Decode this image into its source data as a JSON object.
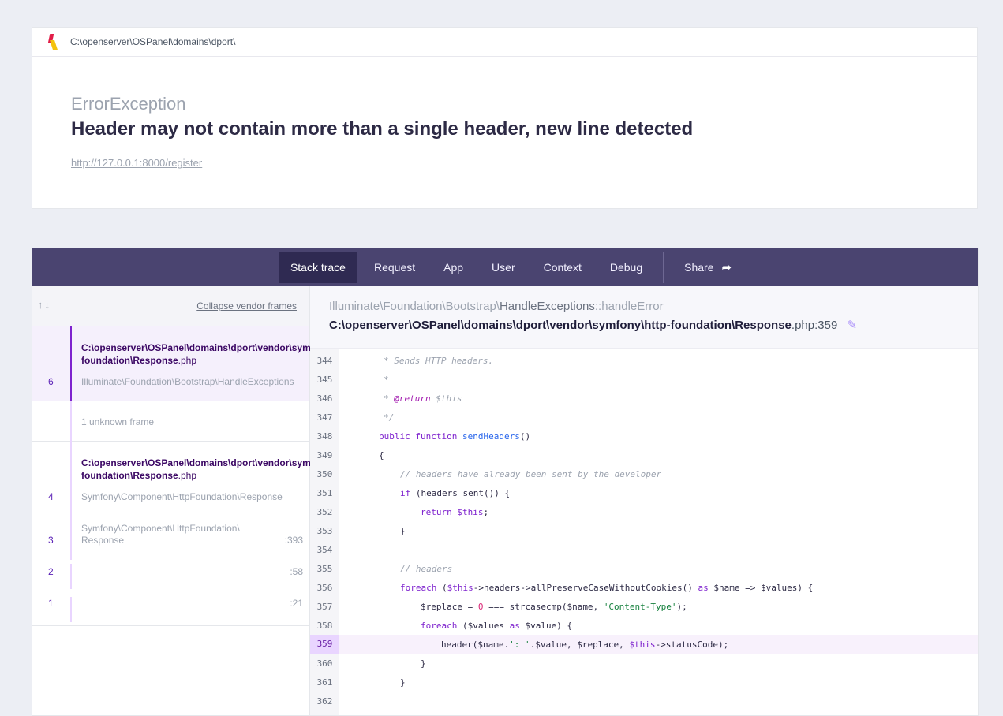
{
  "header": {
    "project_path": "C:\\openserver\\OSPanel\\domains\\dport\\",
    "exception_type": "ErrorException",
    "exception_message": "Header may not contain more than a single header, new line detected",
    "request_url": "http://127.0.0.1:8000/register"
  },
  "tabs": [
    {
      "label": "Stack trace"
    },
    {
      "label": "Request"
    },
    {
      "label": "App"
    },
    {
      "label": "User"
    },
    {
      "label": "Context"
    },
    {
      "label": "Debug"
    }
  ],
  "share_label": "Share",
  "frames_panel": {
    "collapse_label": "Collapse vendor frames",
    "frames": [
      {
        "number": "6",
        "file": "C:\\openserver\\OSPanel\\domains\\dport\\vendor\\symfony\\http-foundation\\Response.php",
        "file_line1": "C:\\openserver\\OSPanel\\domains\\dport\\vendor\\symfony\\http-",
        "file_line2_bold": "foundation\\Response",
        "file_line2_ext": ".php",
        "class": "Illuminate\\Foundation\\Bootstrap\\HandleExceptions",
        "selected": true
      },
      {
        "number": "",
        "class": "1 unknown frame"
      },
      {
        "number": "4",
        "file_line1": "C:\\openserver\\OSPanel\\domains\\dport\\vendor\\symfony\\http-",
        "file_line2_bold": "foundation\\Response",
        "file_line2_ext": ".php",
        "class": "Symfony\\Component\\HttpFoundation\\Response"
      },
      {
        "number": "3",
        "class_line1": "Symfony\\Component\\HttpFoundation\\",
        "class_line2": "Response",
        "line": ":393"
      },
      {
        "number": "2",
        "line": ":58"
      },
      {
        "number": "1",
        "line": ":21"
      }
    ]
  },
  "code_view": {
    "class_prefix": "Illuminate\\Foundation\\Bootstrap\\",
    "class_name": "HandleExceptions",
    "method": "::handleError",
    "file_bold": "C:\\openserver\\OSPanel\\domains\\dport\\vendor\\symfony\\http-foundation\\Response",
    "file_ext": ".php",
    "file_line": ":359",
    "highlight_line": 359,
    "lines": [
      {
        "n": "344"
      },
      {
        "n": "345"
      },
      {
        "n": "346"
      },
      {
        "n": "347"
      },
      {
        "n": "348"
      },
      {
        "n": "349"
      },
      {
        "n": "350"
      },
      {
        "n": "351"
      },
      {
        "n": "352"
      },
      {
        "n": "353"
      },
      {
        "n": "354"
      },
      {
        "n": "355"
      },
      {
        "n": "356"
      },
      {
        "n": "357"
      },
      {
        "n": "358"
      },
      {
        "n": "359"
      },
      {
        "n": "360"
      },
      {
        "n": "361"
      },
      {
        "n": "362"
      }
    ],
    "code_text": {
      "l344": "* Sends HTTP headers.",
      "l345": "*",
      "l346_a": "* ",
      "l346_tag": "@return",
      "l346_b": " $this",
      "l347": "*/",
      "l348_kw": "public function",
      "l348_fn": "sendHeaders",
      "l348_rest": "()",
      "l349": "{",
      "l350": "// headers have already been sent by the developer",
      "l351_kw": "if",
      "l351_rest": " (headers_sent()) {",
      "l352_kw": "return",
      "l352_var": "$this",
      "l352_rest": ";",
      "l353": "}",
      "l355": "// headers",
      "l356_kw": "foreach",
      "l356_a": " (",
      "l356_var": "$this",
      "l356_b": "->headers->allPreserveCaseWithoutCookies() ",
      "l356_as": "as",
      "l356_c": " $name => $values) {",
      "l357_a": "$replace = ",
      "l357_num": "0",
      "l357_b": " === strcasecmp($name, ",
      "l357_str": "'Content-Type'",
      "l357_c": ");",
      "l358_kw": "foreach",
      "l358_a": " ($values ",
      "l358_as": "as",
      "l358_b": " $value) {",
      "l359_a": "header($name.",
      "l359_str": "': '",
      "l359_b": ".$value, $replace, ",
      "l359_var": "$this",
      "l359_c": "->statusCode);",
      "l360": "}",
      "l361": "}"
    }
  },
  "colors": {
    "tabbar": "#4a4470",
    "tab_active": "#2f2a52",
    "accent": "#7e22ce",
    "page_bg": "#eceef4"
  }
}
